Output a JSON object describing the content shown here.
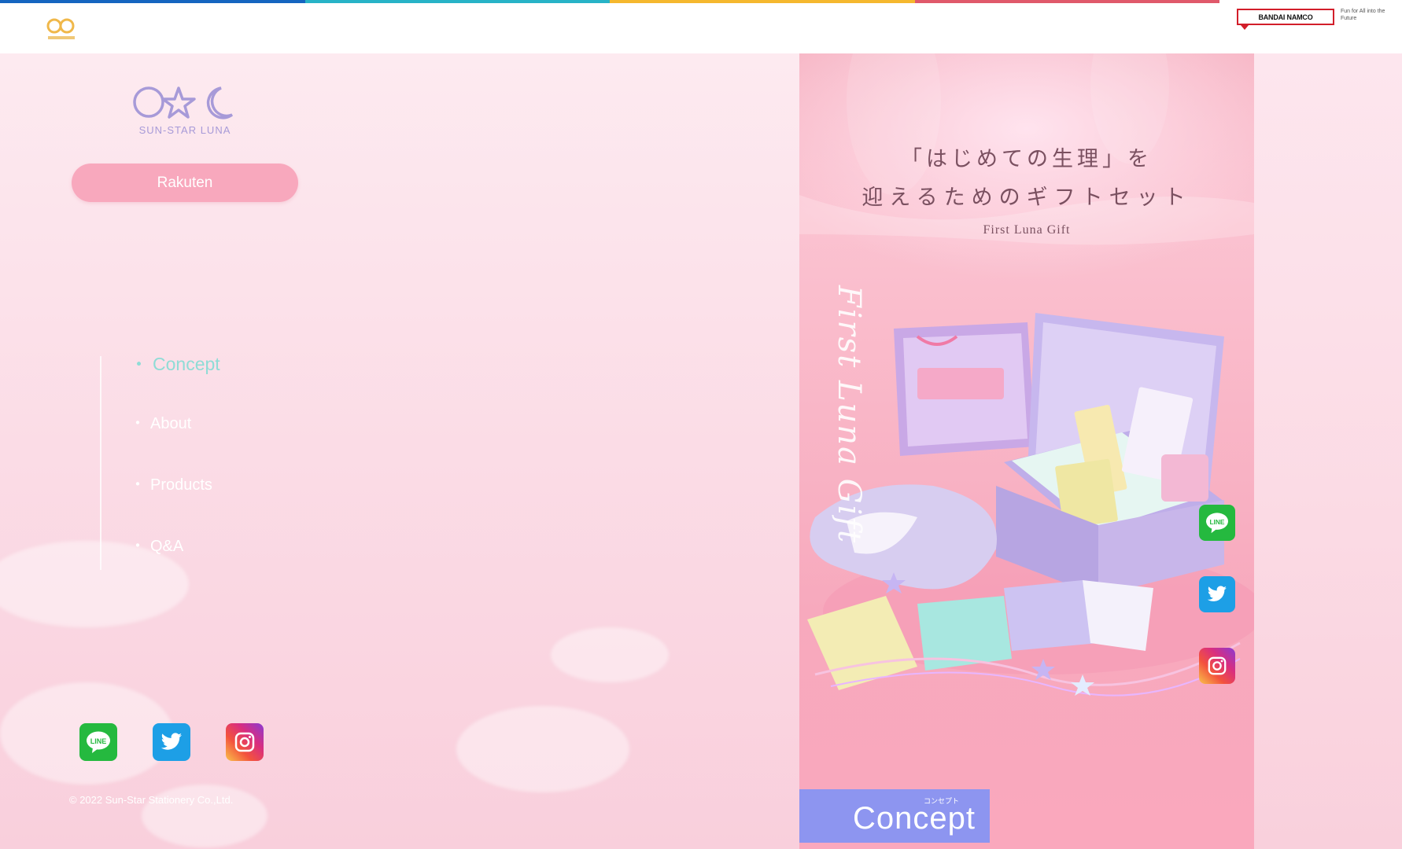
{
  "header": {
    "stripe_colors": [
      "#1565c0",
      "#27b3c7",
      "#f5b82e",
      "#e0596b"
    ],
    "bandai_badge": "BANDAI NAMCO",
    "bandai_tagline": "Fun for All into the Future"
  },
  "brand": {
    "name": "SUN-STAR LUNA",
    "rakuten_label": "Rakuten",
    "accent_color": "#f8a8bd"
  },
  "nav": {
    "items": [
      {
        "bullet": "・",
        "label": "Concept",
        "active": true
      },
      {
        "bullet": "・",
        "label": "About",
        "active": false
      },
      {
        "bullet": "・",
        "label": "Products",
        "active": false
      },
      {
        "bullet": "・",
        "label": "Q&A",
        "active": false
      }
    ]
  },
  "social": {
    "icons": [
      "line-icon",
      "twitter-icon",
      "instagram-icon"
    ]
  },
  "footer": {
    "copyright": "© 2022 Sun-Star Stationery Co.,Ltd."
  },
  "hero": {
    "line1": "「はじめての生理」を",
    "line2": "迎えるためのギフトセット",
    "subtitle": "First Luna Gift",
    "script_text": "First Luna Gift"
  },
  "section": {
    "label": "Concept",
    "ruby": "コンセプト",
    "color": "#8d95f0"
  }
}
